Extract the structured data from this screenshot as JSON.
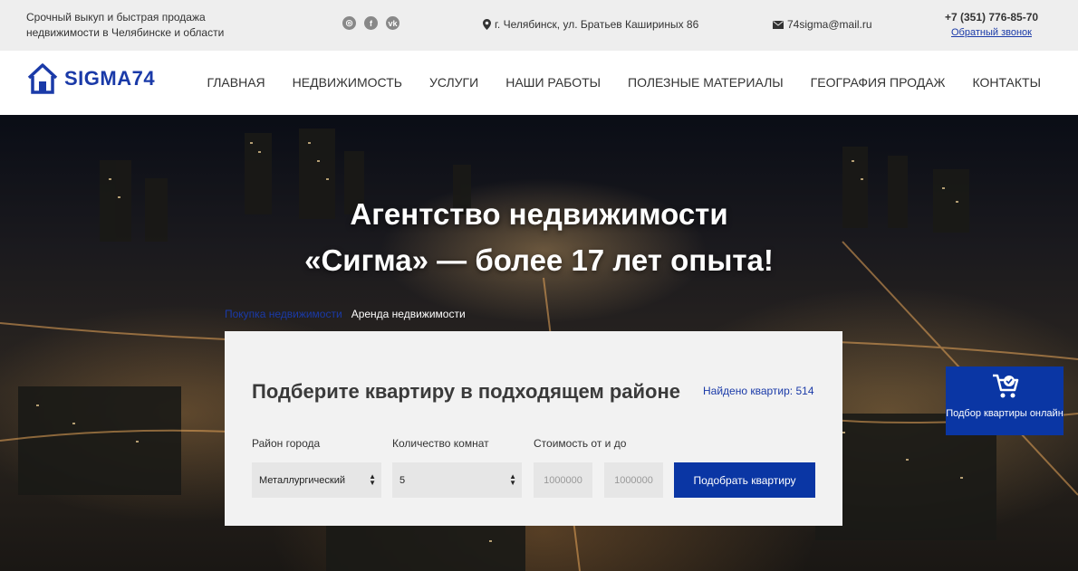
{
  "topbar": {
    "tagline": "Срочный выкуп и быстрая продажа недвижимости в Челябинске и области",
    "socials": [
      "instagram-icon",
      "facebook-icon",
      "vk-icon"
    ],
    "address": "г. Челябинск, ул. Братьев Кашириных 86",
    "email": "74sigma@mail.ru",
    "phone": "+7 (351) 776-85-70",
    "callback": "Обратный звонок"
  },
  "header": {
    "logo": "SIGMA74",
    "nav": [
      "ГЛАВНАЯ",
      "НЕДВИЖИМОСТЬ",
      "УСЛУГИ",
      "НАШИ РАБОТЫ",
      "ПОЛЕЗНЫЕ МАТЕРИАЛЫ",
      "ГЕОГРАФИЯ ПРОДАЖ",
      "КОНТАКТЫ"
    ]
  },
  "hero": {
    "title_line1": "Агентство недвижимости",
    "title_line2": "«Сигма» — более 17 лет опыта!",
    "tabs": [
      "Покупка недвижимости",
      "Аренда недвижимости"
    ],
    "active_tab": "Аренда недвижимости"
  },
  "search": {
    "title": "Подберите квартиру в подходящем районе",
    "found": "Найдено квартир: 514",
    "district_label": "Район города",
    "district_value": "Металлургический",
    "rooms_label": "Количество комнат",
    "rooms_value": "5",
    "price_label": "Стоимость от и до",
    "price_from_placeholder": "1000000",
    "price_to_placeholder": "1000000",
    "submit": "Подобрать квартиру"
  },
  "widget": {
    "label": "Подбор квартиры онлайн",
    "icon": "cart-icon"
  },
  "colors": {
    "brand": "#1a3aa8",
    "button": "#0a36a4",
    "topbar_bg": "#eeeeee",
    "panel_bg": "#f2f2f2"
  }
}
